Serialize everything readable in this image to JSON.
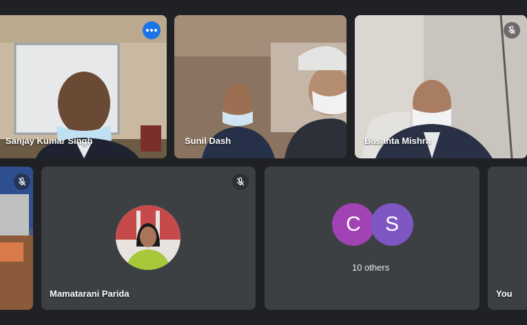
{
  "participants": [
    {
      "name": "Sanjay Kumar Singh",
      "pinned": true
    },
    {
      "name": "Sunil Dash"
    },
    {
      "name": "Basanta Mishra",
      "muted": true
    },
    {
      "name": "",
      "muted": true
    },
    {
      "name": "Mamatarani Parida",
      "muted": true
    },
    {
      "name": "You"
    }
  ],
  "others_group": {
    "label": "10 others",
    "avatars": [
      {
        "initial": "C",
        "color": "#a142b5"
      },
      {
        "initial": "S",
        "color": "#7e57c2"
      }
    ]
  },
  "colors": {
    "background": "#202124",
    "tile": "#3c4043",
    "active_border": "#8ab4f8",
    "more_button": "#1a73e8"
  },
  "icons": [
    "more-options-icon",
    "mic-off-icon"
  ]
}
